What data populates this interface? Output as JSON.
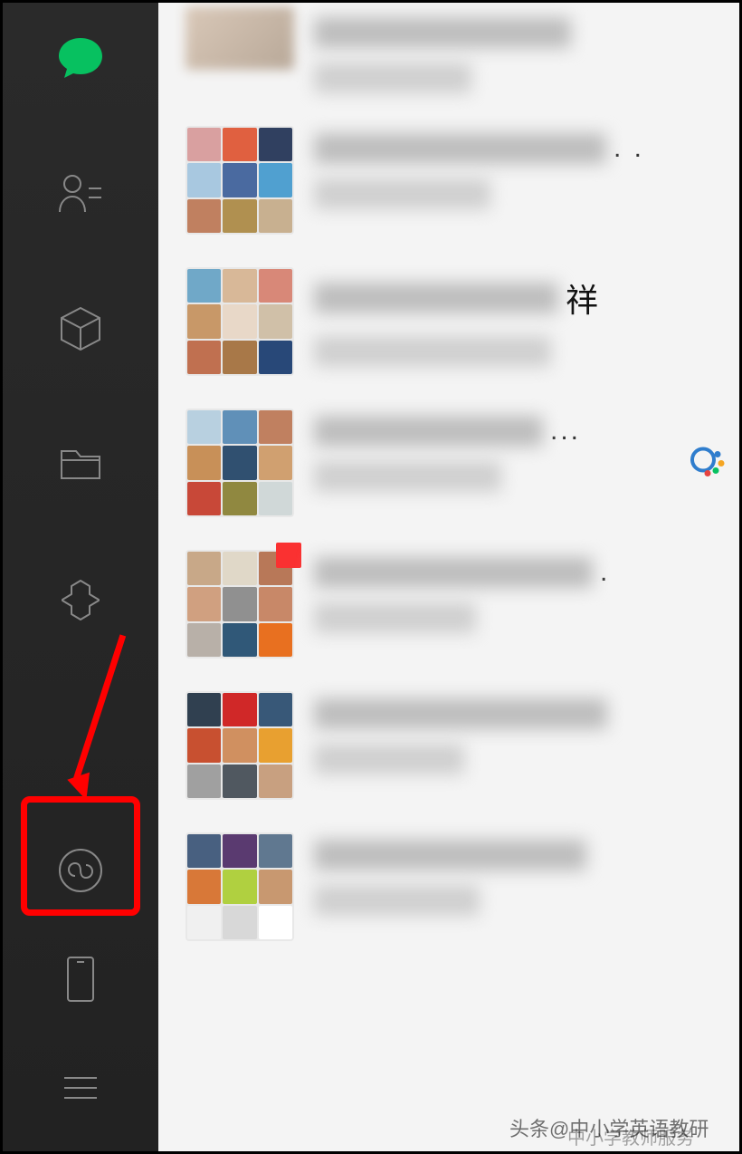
{
  "sidebar": {
    "icons": [
      "chat",
      "contacts",
      "favorites",
      "files",
      "browse",
      "miniprogram",
      "phone",
      "menu"
    ]
  },
  "chats": [
    {
      "type": "single",
      "suffix": "",
      "dots": "",
      "badge": false,
      "wecom": false
    },
    {
      "type": "grid",
      "suffix": "",
      "dots": ". .",
      "badge": false,
      "wecom": false,
      "colors": [
        "#d9a0a0",
        "#e06040",
        "#304060",
        "#a8c8e0",
        "#4a6aa0",
        "#50a0d0",
        "#c08060",
        "#b09050",
        "#c8b090"
      ]
    },
    {
      "type": "grid",
      "suffix": "祥",
      "dots": "",
      "badge": false,
      "wecom": false,
      "colors": [
        "#70a8c8",
        "#d8b898",
        "#d88878",
        "#c89868",
        "#e8d8c8",
        "#d0c0a8",
        "#c07050",
        "#a87848",
        "#284878"
      ]
    },
    {
      "type": "grid",
      "suffix": "",
      "dots": "...",
      "badge": false,
      "wecom": true,
      "colors": [
        "#b8d0e0",
        "#6090b8",
        "#c08060",
        "#c89058",
        "#305070",
        "#d0a070",
        "#c84838",
        "#908840",
        "#d0d8d8"
      ]
    },
    {
      "type": "grid",
      "suffix": "",
      "dots": ".",
      "badge": true,
      "wecom": false,
      "colors": [
        "#c8a888",
        "#e0d8c8",
        "#b87858",
        "#d0a080",
        "#909090",
        "#c88868",
        "#b8b0a8",
        "#305878",
        "#e87020"
      ]
    },
    {
      "type": "grid",
      "suffix": "",
      "dots": "",
      "badge": false,
      "wecom": false,
      "colors": [
        "#304050",
        "#d02828",
        "#385878",
        "#c85030",
        "#d09060",
        "#e8a030",
        "#a0a0a0",
        "#505860",
        "#c8a080"
      ]
    },
    {
      "type": "grid",
      "suffix": "",
      "dots": "",
      "badge": false,
      "wecom": false,
      "colors": [
        "#486080",
        "#5a3a70",
        "#607890",
        "#d87838",
        "#b0d040",
        "#c89870",
        "#f0f0f0",
        "#d8d8d8",
        "#ffffff"
      ]
    }
  ],
  "annotation": {
    "target": "miniprogram"
  },
  "watermark": {
    "text1": "头条@中小学英语教研",
    "text2": "中小学教师服务"
  }
}
